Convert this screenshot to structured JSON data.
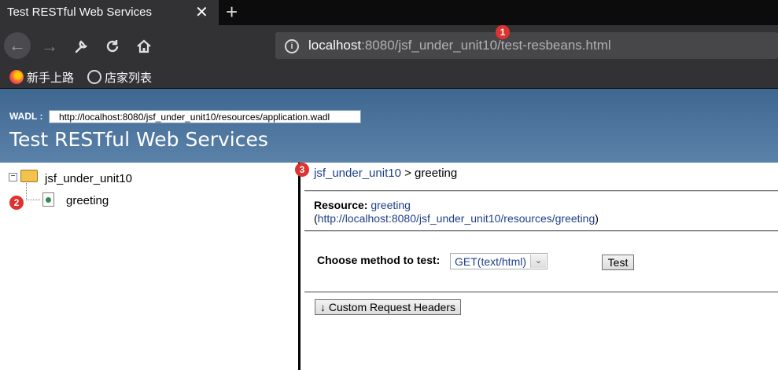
{
  "browser": {
    "tab_title": "Test RESTful Web Services",
    "tab_close_glyph": "✕",
    "new_tab_glyph": "+",
    "nav": {
      "back_glyph": "←",
      "forward_glyph": "→",
      "wrench_glyph": "🔧",
      "reload_glyph": "↻",
      "home_glyph": "⌂"
    },
    "url_host": "localhost",
    "url_rest": ":8080/jsf_under_unit10/test-resbeans.html",
    "info_glyph": "i",
    "bookmarks": [
      {
        "label": "新手上路",
        "icon": "firefox-icon"
      },
      {
        "label": "店家列表",
        "icon": "globe-icon"
      }
    ]
  },
  "header": {
    "wadl_label": "WADL :",
    "wadl_url": "http://localhost:8080/jsf_under_unit10/resources/application.wadl",
    "title": "Test RESTful Web Services"
  },
  "tree": {
    "toggle": "−",
    "root": "jsf_under_unit10",
    "child": "greeting"
  },
  "panel": {
    "crumb_link": "jsf_under_unit10",
    "crumb_sep": " > ",
    "crumb_current": "greeting",
    "resource_label": "Resource:",
    "resource_name": "greeting",
    "resource_open": "(",
    "resource_url": "http://localhost:8080/jsf_under_unit10/resources/greeting",
    "resource_close": ")",
    "method_label": "Choose method to test:",
    "method_value": "GET(text/html)",
    "select_arrow": "⌄",
    "test_button": "Test",
    "headers_button": "↓ Custom Request Headers"
  },
  "markers": [
    "1",
    "2",
    "3"
  ]
}
